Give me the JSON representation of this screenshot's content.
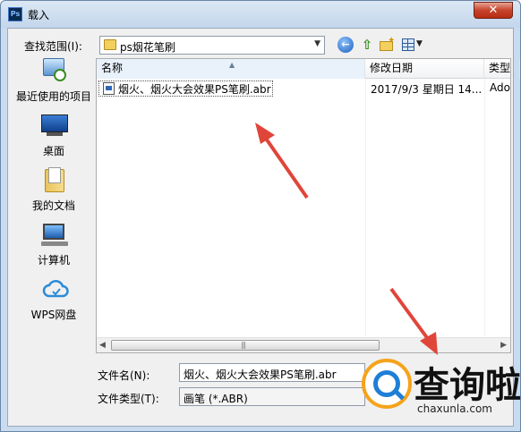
{
  "window": {
    "app_icon_text": "Ps",
    "title": "载入",
    "close_symbol": "✕"
  },
  "toolbar": {
    "lookin_label": "查找范围(I):",
    "lookin_value": "ps烟花笔刷",
    "icons": [
      "back-icon",
      "up-folder-icon",
      "new-folder-icon",
      "view-menu-icon"
    ]
  },
  "places": [
    {
      "label": "最近使用的项目",
      "icon": "recent-items-icon"
    },
    {
      "label": "桌面",
      "icon": "desktop-icon"
    },
    {
      "label": "我的文档",
      "icon": "documents-icon"
    },
    {
      "label": "计算机",
      "icon": "computer-icon"
    },
    {
      "label": "WPS网盘",
      "icon": "wps-cloud-icon"
    }
  ],
  "filelist": {
    "columns": [
      "名称",
      "修改日期",
      "类型"
    ],
    "rows": [
      {
        "name": "烟火、烟火大会效果PS笔刷.abr",
        "date": "2017/9/3 星期日 14...",
        "type": "Ado"
      }
    ]
  },
  "fields": {
    "filename_label": "文件名(N):",
    "filename_value": "烟火、烟火大会效果PS笔刷.abr",
    "filetype_label": "文件类型(T):",
    "filetype_value": "画笔 (*.ABR)"
  },
  "watermark": {
    "text": "查询啦",
    "sub": "chaxunla.com"
  },
  "colors": {
    "annotation_arrow": "#e0453a",
    "watermark_orange": "#f5a31b",
    "watermark_blue": "#1e7fd6"
  }
}
